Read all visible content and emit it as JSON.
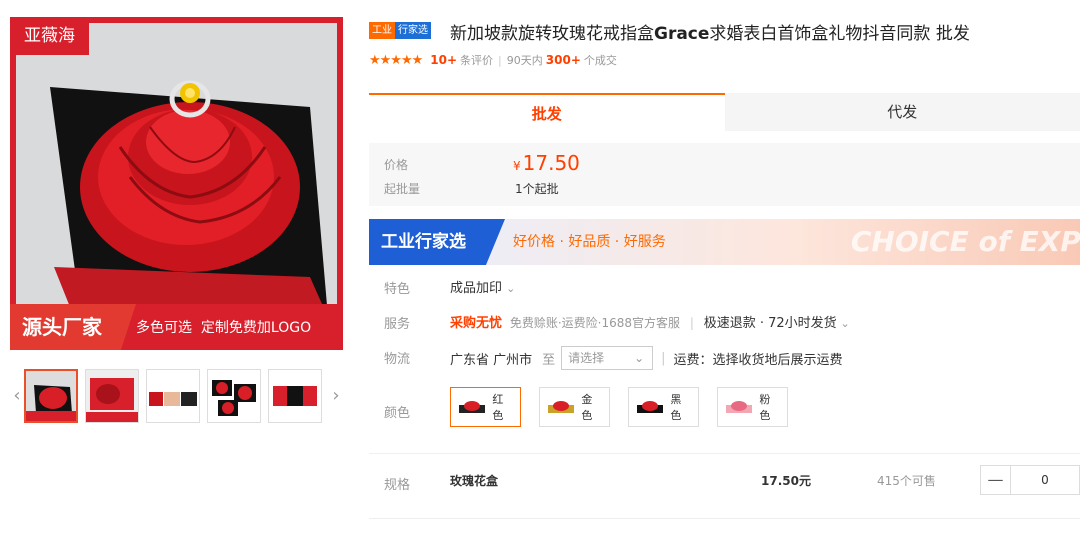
{
  "gallery": {
    "brand_ribbon": "亚薇海",
    "banner_main": "源头厂家",
    "banner_sub": "多色可选  定制免费加LOGO",
    "prev_arrow": "‹",
    "next_arrow": "›"
  },
  "product": {
    "badge_left": "工业",
    "badge_right": "行家选",
    "title_pre": "新加坡款旋转玫瑰花戒指盒",
    "title_bold": "Grace",
    "title_post": "求婚表白首饰盒礼物抖音同款 批发",
    "stars": "★★★★★",
    "review_count": "10+",
    "review_label": "条评价",
    "sales_period": "90天内",
    "sales_count": "300+",
    "sales_label": "个成交"
  },
  "tabs": [
    {
      "label": "批发",
      "active": true
    },
    {
      "label": "代发",
      "active": false
    }
  ],
  "price": {
    "price_label": "价格",
    "currency": "¥",
    "value": "17.50",
    "moq_label": "起批量",
    "moq_value": "1个起批"
  },
  "industry": {
    "tag": "工业行家选",
    "slogan": "好价格 · 好品质 · 好服务",
    "watermark": "CHOICE of EXPE"
  },
  "feature": {
    "label": "特色",
    "value": "成品加印",
    "chevron": "⌄"
  },
  "service": {
    "label": "服务",
    "highlight": "采购无忧",
    "items": "免费赊账·运费险·1688官方客服",
    "sep": "|",
    "fast": "极速退款 · 72小时发货",
    "chevron": "⌄"
  },
  "logistics": {
    "label": "物流",
    "origin": "广东省 广州市",
    "to": "至",
    "select_placeholder": "请选择",
    "sep": "|",
    "freight": "运费：选择收货地后展示运费"
  },
  "colors": {
    "label": "颜色",
    "options": [
      {
        "label": "红色",
        "selected": true
      },
      {
        "label": "金色",
        "selected": false
      },
      {
        "label": "黑色",
        "selected": false
      },
      {
        "label": "粉色",
        "selected": false
      }
    ]
  },
  "spec": {
    "label": "规格",
    "name": "玫瑰花盒",
    "price": "17.50元",
    "stock": "415个可售",
    "minus": "—",
    "qty": "0"
  }
}
